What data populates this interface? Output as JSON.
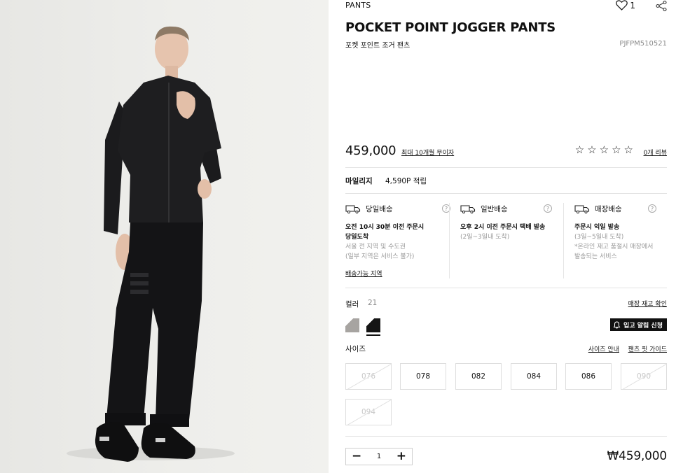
{
  "product": {
    "category": "PANTS",
    "title": "POCKET POINT JOGGER PANTS",
    "subtitle": "포켓 포인트 조거 팬츠",
    "code": "PJFPM510521",
    "wishlist_count": "1",
    "price": "459,000",
    "installment": "최대 10개월 무이자",
    "rating": 0,
    "stars": [
      "☆",
      "☆",
      "☆",
      "☆",
      "☆"
    ],
    "review_link": "0개 리뷰"
  },
  "mileage": {
    "label": "마일리지",
    "value": "4,590P 적립"
  },
  "shipping": [
    {
      "icon": "same-day-truck-icon",
      "title": "당일배송",
      "bold": [
        "오전 10시 30분 이전 주문시",
        "당일도착"
      ],
      "sub": [
        "서울 전 지역 및 수도권",
        "(일부 지역은 서비스 불가)"
      ]
    },
    {
      "icon": "delivery-truck-icon",
      "title": "일반배송",
      "bold": [
        "오후 2시 이전 주문시 택배 발송"
      ],
      "sub": [
        "(2일~3일내 도착)"
      ]
    },
    {
      "icon": "store-truck-icon",
      "title": "매장배송",
      "bold": [
        "주문시 익일 발송"
      ],
      "sub": [
        "(3일~5일내 도착)",
        "*온라인 재고 품절시 매장에서",
        "발송되는 서비스"
      ]
    }
  ],
  "shipping_link": "배송가능 지역",
  "help_mark": "?",
  "color": {
    "label": "컬러",
    "count": "21",
    "stock_link": "매장 재고 확인",
    "notify_label": "입고 알림 신청",
    "swatches": [
      "#a7a4a1",
      "#151515"
    ],
    "selected_index": 1
  },
  "size": {
    "label": "사이즈",
    "guide_link": "사이즈 안내",
    "fit_link": "팬츠 핏 가이드",
    "options": [
      {
        "label": "076",
        "available": false
      },
      {
        "label": "078",
        "available": true
      },
      {
        "label": "082",
        "available": true
      },
      {
        "label": "084",
        "available": true
      },
      {
        "label": "086",
        "available": true
      },
      {
        "label": "090",
        "available": false
      },
      {
        "label": "094",
        "available": false
      }
    ]
  },
  "order": {
    "minus": "−",
    "plus": "+",
    "quantity": "1",
    "total": "₩459,000"
  }
}
